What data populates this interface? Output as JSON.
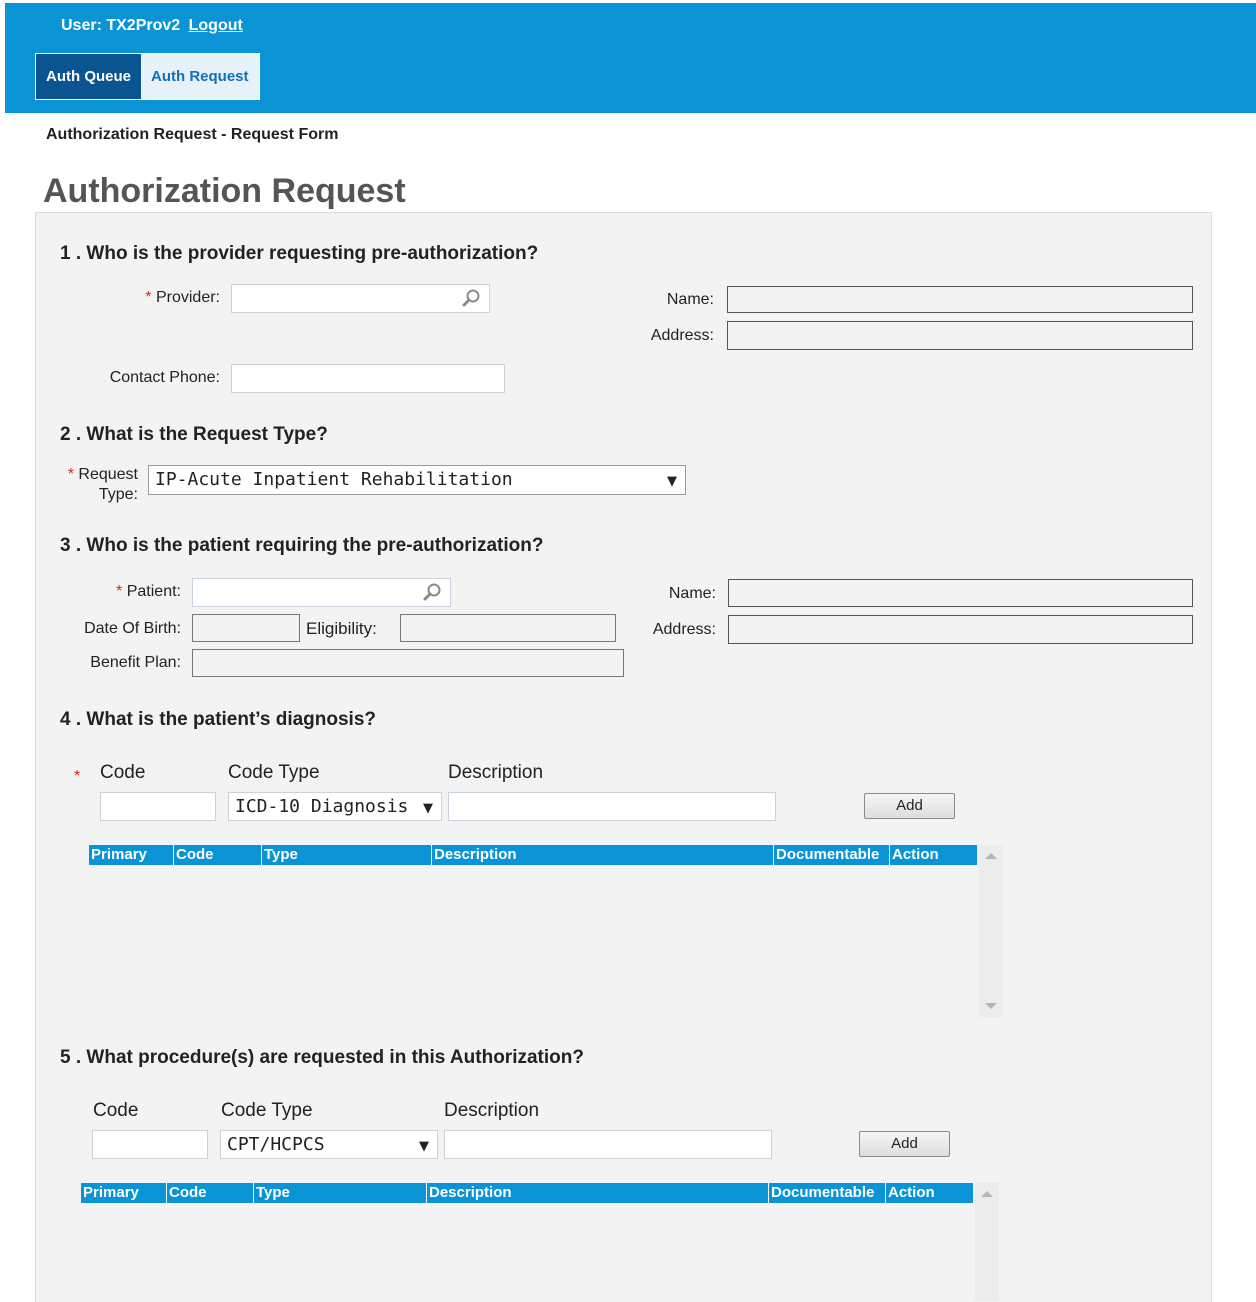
{
  "header": {
    "user_label": "User: TX2Prov2",
    "logout_label": "Logout",
    "tabs": [
      {
        "label": "Auth Queue",
        "active": true
      },
      {
        "label": "Auth Request",
        "active": false
      }
    ]
  },
  "breadcrumb": "Authorization Request - Request Form",
  "page_title": "Authorization Request",
  "required_marker": "*",
  "section1": {
    "title": "1 . Who is the provider requesting pre-authorization?",
    "provider_label": "Provider:",
    "provider_value": "",
    "name_label": "Name:",
    "address_label": "Address:",
    "contact_phone_label": "Contact Phone:",
    "contact_phone_value": ""
  },
  "section2": {
    "title": "2 . What is the Request Type?",
    "request_label_line1": "Request",
    "request_label_line2": "Type:",
    "request_type_value": "IP-Acute Inpatient Rehabilitation"
  },
  "section3": {
    "title": "3 . Who is the patient requiring the pre-authorization?",
    "patient_label": "Patient:",
    "name_label": "Name:",
    "dob_label": "Date Of Birth:",
    "eligibility_label": "Eligibility:",
    "address_label": "Address:",
    "benefit_plan_label": "Benefit Plan:"
  },
  "section4": {
    "title": "4 . What is the patient’s diagnosis?",
    "code_label": "Code",
    "code_type_label": "Code Type",
    "description_label": "Description",
    "code_type_value": "ICD-10 Diagnosis",
    "add_label": "Add",
    "grid_columns": [
      "Primary",
      "Code",
      "Type",
      "Description",
      "Documentable",
      "Action"
    ]
  },
  "section5": {
    "title": "5 . What procedure(s) are requested in this Authorization?",
    "code_label": "Code",
    "code_type_label": "Code Type",
    "description_label": "Description",
    "code_type_value": "CPT/HCPCS",
    "add_label": "Add",
    "grid_columns": [
      "Primary",
      "Code",
      "Type",
      "Description",
      "Documentable",
      "Action"
    ]
  },
  "colors": {
    "header_bg": "#0a94d6",
    "active_tab_bg": "#0a5591",
    "required": "#e2231a",
    "panel_bg": "#f3f3f3"
  },
  "icons": {
    "lookup": "magnifier-icon",
    "dropdown": "caret-down-icon",
    "scroll_up": "scroll-up-arrow-icon",
    "scroll_down": "scroll-down-arrow-icon"
  }
}
